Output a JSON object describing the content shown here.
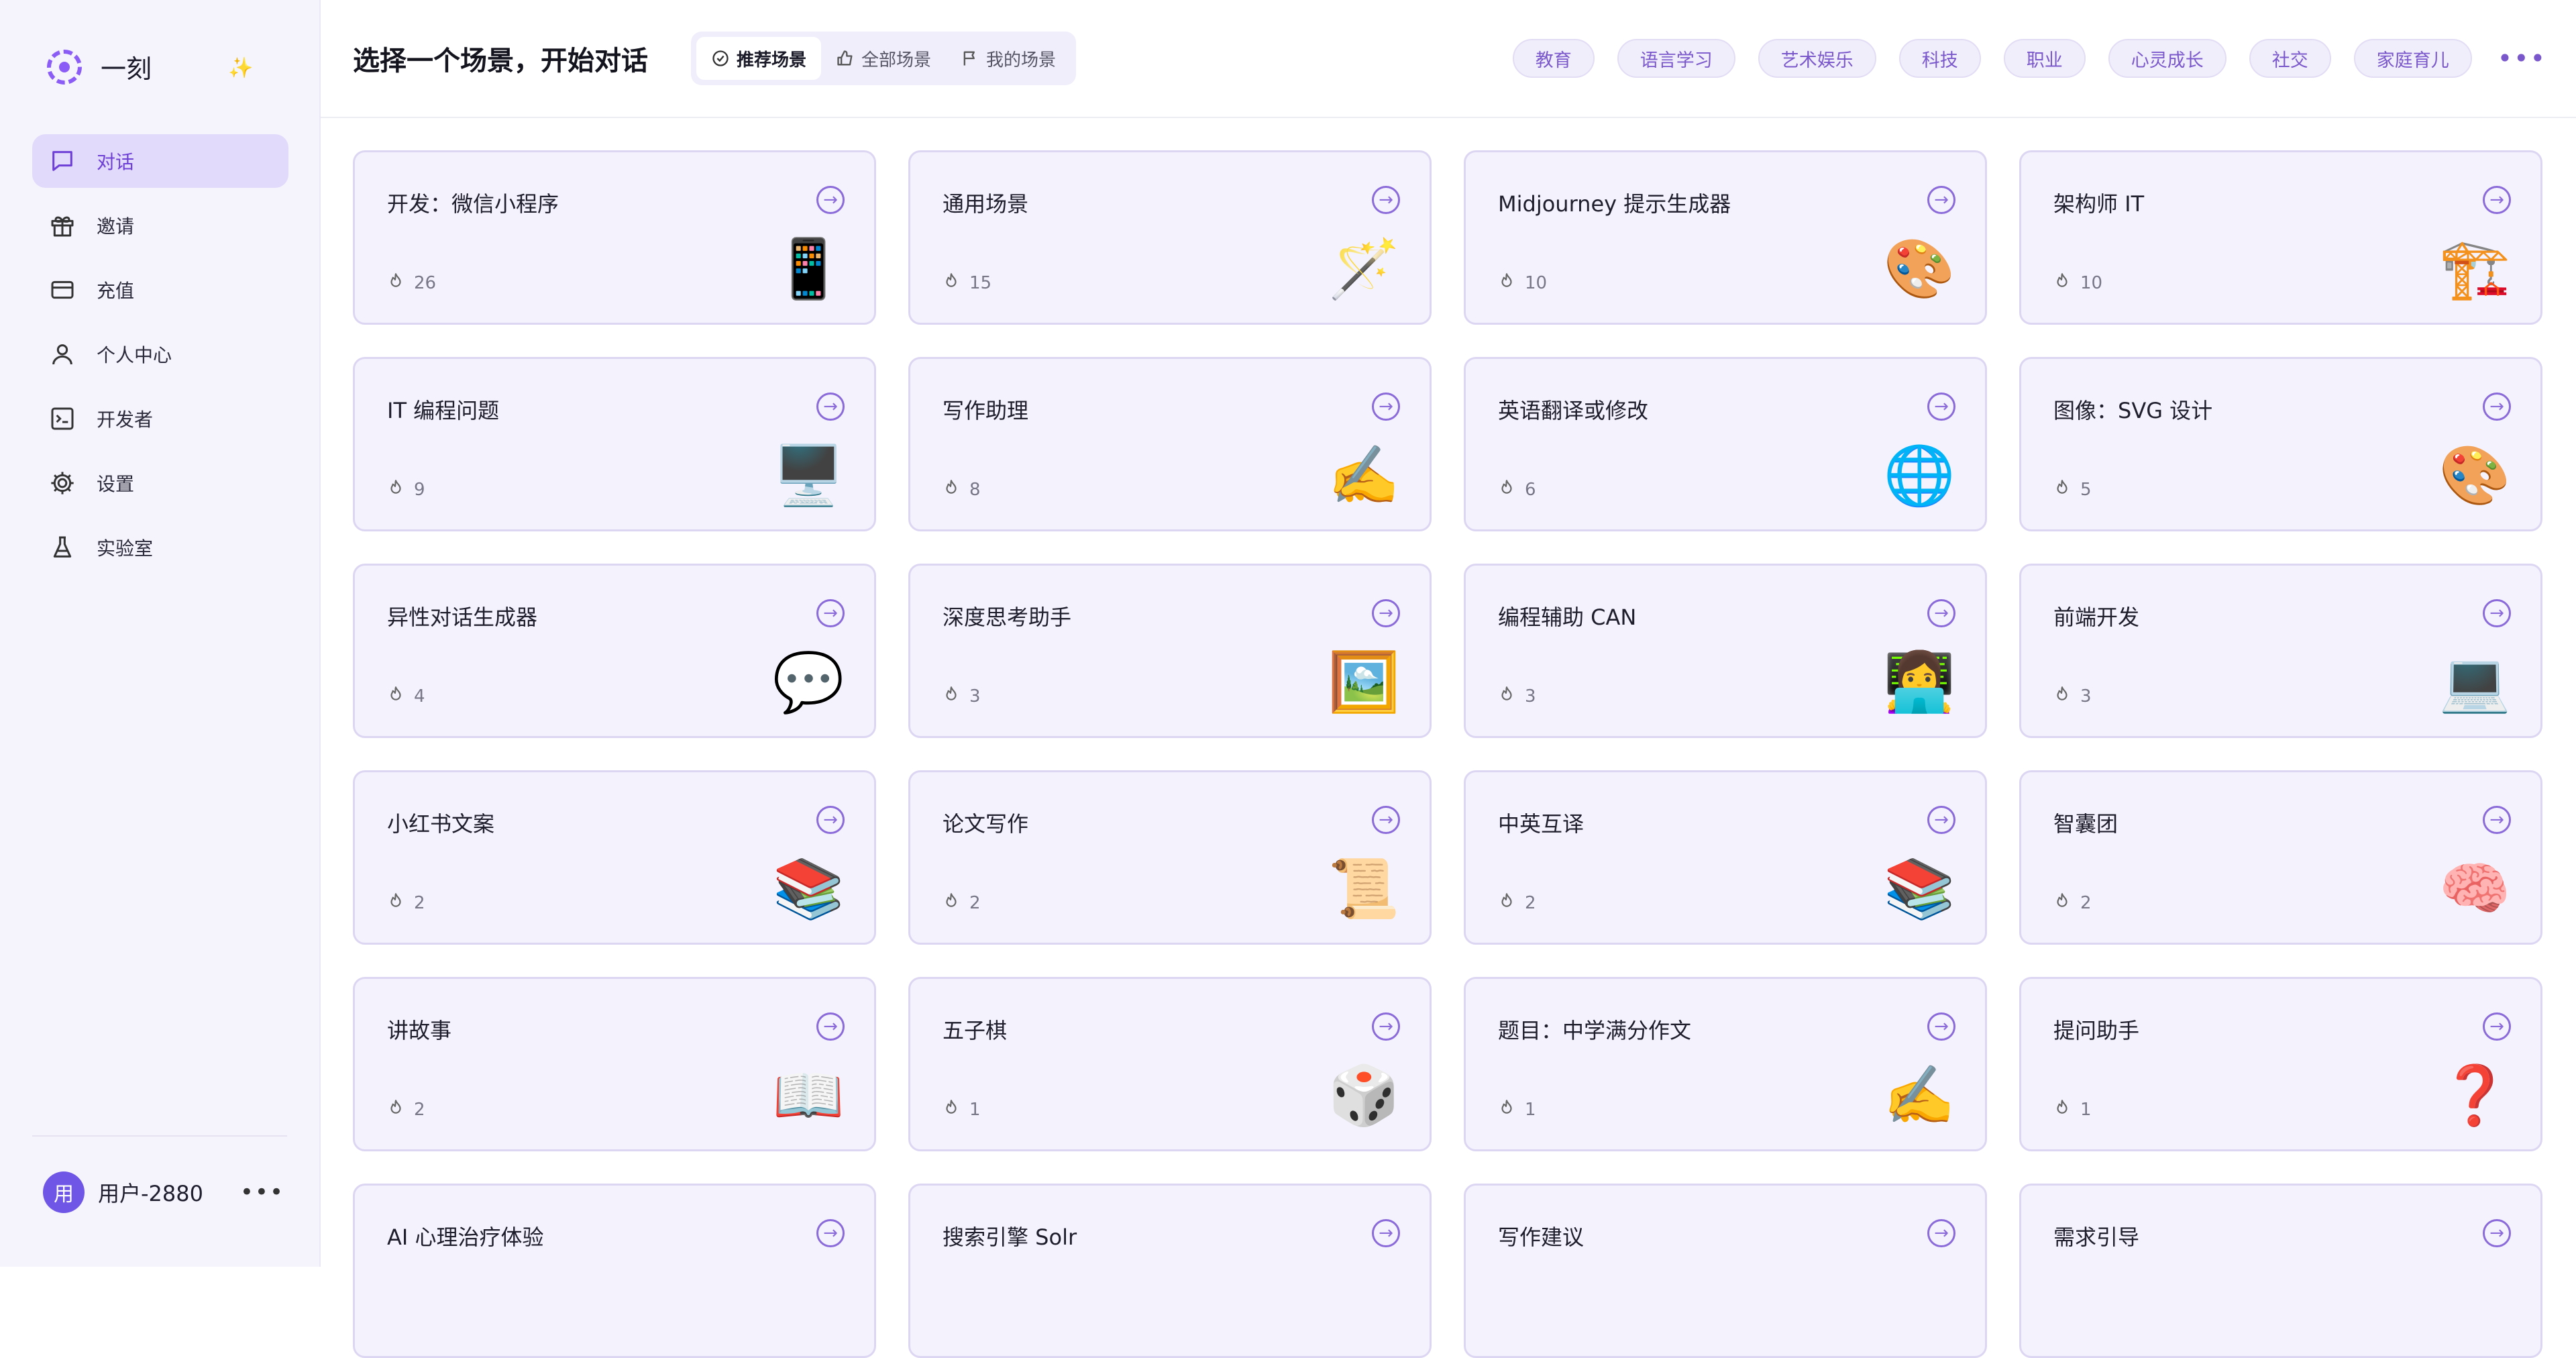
{
  "brand": {
    "name": "一刻",
    "logo_icon": "spiral-logo-icon",
    "collapse_icon": "sparkle-icon"
  },
  "sidebar": {
    "items": [
      {
        "label": "对话",
        "icon": "chat-icon",
        "active": true
      },
      {
        "label": "邀请",
        "icon": "gift-icon"
      },
      {
        "label": "充值",
        "icon": "credit-card-icon"
      },
      {
        "label": "个人中心",
        "icon": "user-icon"
      },
      {
        "label": "开发者",
        "icon": "terminal-icon"
      },
      {
        "label": "设置",
        "icon": "gear-icon"
      },
      {
        "label": "实验室",
        "icon": "flask-icon"
      }
    ]
  },
  "user": {
    "avatar_text": "用",
    "name": "用户-2880",
    "more": "•••"
  },
  "header": {
    "title": "选择一个场景，开始对话",
    "tabs": [
      {
        "label": "推荐场景",
        "icon": "check-circle-icon",
        "active": true
      },
      {
        "label": "全部场景",
        "icon": "thumbs-up-icon"
      },
      {
        "label": "我的场景",
        "icon": "flag-icon"
      }
    ],
    "tags": [
      "教育",
      "语言学习",
      "艺术娱乐",
      "科技",
      "职业",
      "心灵成长",
      "社交",
      "家庭育儿"
    ],
    "more": "•••"
  },
  "cards": [
    {
      "title": "开发：微信小程序",
      "count": "26",
      "emoji": "📱"
    },
    {
      "title": "通用场景",
      "count": "15",
      "emoji": "🪄"
    },
    {
      "title": "Midjourney 提示生成器",
      "count": "10",
      "emoji": "🎨"
    },
    {
      "title": "架构师 IT",
      "count": "10",
      "emoji": "🏗️"
    },
    {
      "title": "IT 编程问题",
      "count": "9",
      "emoji": "🖥️"
    },
    {
      "title": "写作助理",
      "count": "8",
      "emoji": "✍️"
    },
    {
      "title": "英语翻译或修改",
      "count": "6",
      "emoji": "🌐"
    },
    {
      "title": "图像：SVG 设计",
      "count": "5",
      "emoji": "🎨"
    },
    {
      "title": "异性对话生成器",
      "count": "4",
      "emoji": "💬"
    },
    {
      "title": "深度思考助手",
      "count": "3",
      "emoji": "🖼️"
    },
    {
      "title": "编程辅助 CAN",
      "count": "3",
      "emoji": "👩‍💻"
    },
    {
      "title": "前端开发",
      "count": "3",
      "emoji": "💻"
    },
    {
      "title": "小红书文案",
      "count": "2",
      "emoji": "📚"
    },
    {
      "title": "论文写作",
      "count": "2",
      "emoji": "📜"
    },
    {
      "title": "中英互译",
      "count": "2",
      "emoji": "📚"
    },
    {
      "title": "智囊团",
      "count": "2",
      "emoji": "🧠"
    },
    {
      "title": "讲故事",
      "count": "2",
      "emoji": "📖"
    },
    {
      "title": "五子棋",
      "count": "1",
      "emoji": "🎲"
    },
    {
      "title": "题目：中学满分作文",
      "count": "1",
      "emoji": "✍️"
    },
    {
      "title": "提问助手",
      "count": "1",
      "emoji": "❓"
    },
    {
      "title": "AI 心理治疗体验",
      "count": "",
      "emoji": ""
    },
    {
      "title": "搜索引擎 Solr",
      "count": "",
      "emoji": ""
    },
    {
      "title": "写作建议",
      "count": "",
      "emoji": ""
    },
    {
      "title": "需求引导",
      "count": "",
      "emoji": ""
    }
  ],
  "colors": {
    "accent": "#8b5cf6",
    "active_nav_bg": "#e2dafb",
    "card_bg": "#f4f2fc",
    "card_border": "#ddd6f3",
    "avatar_bg": "#6f56e6"
  }
}
